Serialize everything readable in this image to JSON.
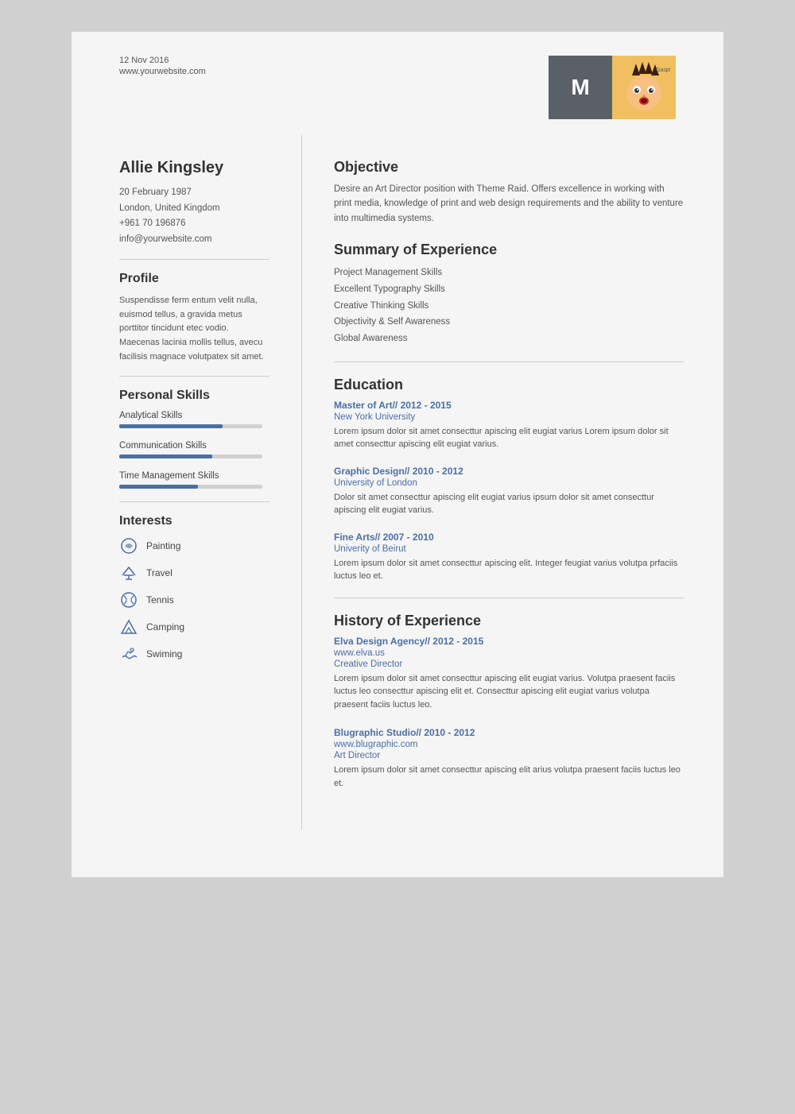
{
  "header": {
    "date": "12 Nov 2016",
    "website": "www.yourwebsite.com",
    "avatar_letter": "M"
  },
  "person": {
    "name": "Allie Kingsley",
    "dob": "20 February 1987",
    "location": "London, United Kingdom",
    "phone": "+961 70 196876",
    "email": "info@yourwebsite.com"
  },
  "profile": {
    "title": "Profile",
    "text": "Suspendisse ferm entum velit nulla, euismod tellus, a gravida metus porttitor tincidunt etec vodio. Maecenas lacinia mollis tellus, avecu facilisis magnace volutpatex sit amet."
  },
  "personal_skills": {
    "title": "Personal Skills",
    "skills": [
      {
        "label": "Analytical Skills",
        "percent": 72
      },
      {
        "label": "Communication Skills",
        "percent": 65
      },
      {
        "label": "Time Management Skills",
        "percent": 55
      }
    ]
  },
  "interests": {
    "title": "Interests",
    "items": [
      {
        "icon": "🌐",
        "label": "Painting"
      },
      {
        "icon": "✈",
        "label": "Travel"
      },
      {
        "icon": "🎾",
        "label": "Tennis"
      },
      {
        "icon": "⛺",
        "label": "Camping"
      },
      {
        "icon": "🏊",
        "label": "Swiming"
      }
    ]
  },
  "objective": {
    "title": "Objective",
    "text": "Desire an Art Director position with Theme Raid. Offers excellence in working with print media, knowledge of print and web design requirements and the ability to venture into multimedia systems."
  },
  "summary": {
    "title": "Summary of Experience",
    "items": [
      "Project Management Skills",
      "Excellent Typography Skills",
      "Creative Thinking Skills",
      "Objectivity & Self Awareness",
      "Global Awareness"
    ]
  },
  "education": {
    "title": "Education",
    "entries": [
      {
        "degree": "Master of Art",
        "years": "// 2012 - 2015",
        "school": "New York University",
        "desc": "Lorem ipsum dolor sit amet consecttur apiscing elit eugiat varius Lorem ipsum dolor sit amet consecttur apiscing elit eugiat varius."
      },
      {
        "degree": "Graphic Design",
        "years": "// 2010 - 2012",
        "school": "University of London",
        "desc": "Dolor sit amet consecttur apiscing elit eugiat varius  ipsum dolor sit amet consecttur apiscing elit eugiat varius."
      },
      {
        "degree": "Fine Arts",
        "years": "// 2007 - 2010",
        "school": "Univerity of Beirut",
        "desc": "Lorem ipsum dolor sit amet consecttur apiscing elit. Integer feugiat varius volutpa prfaciis luctus leo et."
      }
    ]
  },
  "history": {
    "title": "History of Experience",
    "entries": [
      {
        "company": "Elva Design Agency",
        "years": "// 2012 - 2015",
        "url": "www.elva.us",
        "role": "Creative Director",
        "desc": "Lorem ipsum dolor sit amet consecttur apiscing elit eugiat varius. Volutpa praesent faciis luctus leo consecttur apiscing elit et. Consecttur apiscing elit eugiat varius volutpa praesent faciis luctus leo."
      },
      {
        "company": "Blugraphic Studio",
        "years": "// 2010 - 2012",
        "url": "www.blugraphic.com",
        "role": "Art Director",
        "desc": "Lorem ipsum dolor sit amet consecttur apiscing elit arius volutpa praesent faciis luctus leo et."
      }
    ]
  }
}
